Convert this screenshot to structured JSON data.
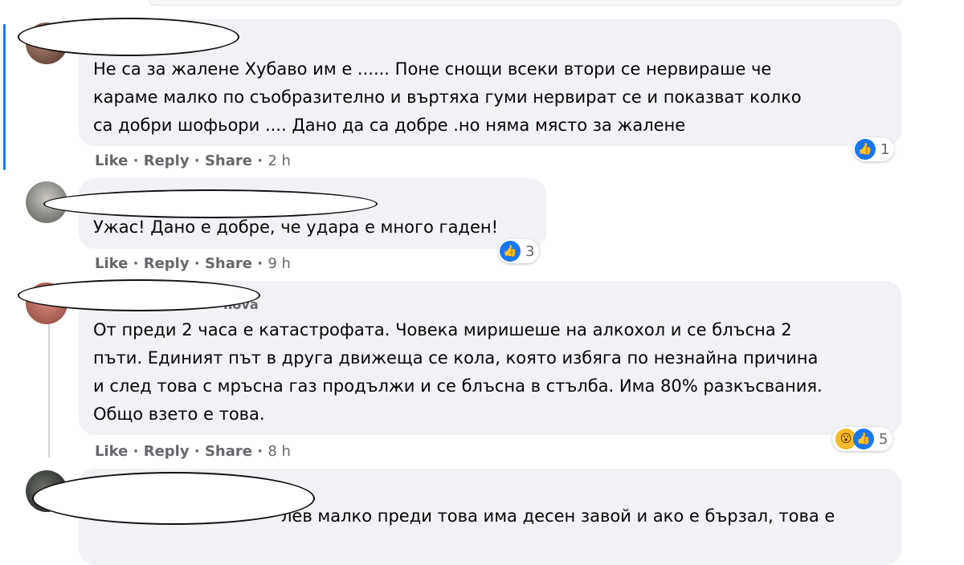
{
  "comments": [
    {
      "name": "",
      "lines": [
        "Не са за жалене Хубаво им е ...... Поне снощи всеки втори се нервираше че",
        "караме малко по съобразително и въртяха гуми нервират се и показват колко",
        "са добри шофьори .... Дано да са добре .но няма място за жалене"
      ],
      "actions": {
        "like": "Like",
        "reply": "Reply",
        "share": "Share",
        "time": "2 h"
      },
      "reactions": {
        "count": "1",
        "icons": [
          "like-icon"
        ]
      }
    },
    {
      "name": "",
      "lines": [
        "Ужас! Дано е добре, че удара е много гаден!"
      ],
      "actions": {
        "like": "Like",
        "reply": "Reply",
        "share": "Share",
        "time": "9 h"
      },
      "reactions": {
        "count": "3",
        "icons": [
          "like-icon"
        ]
      }
    },
    {
      "name": "nova",
      "lines": [
        "От преди 2 часа е катастрофата. Човека миришеше на алкохол и се блъсна 2",
        "пъти. Единият път в друга движеща се кола, която избяга по незнайна причина",
        "и след това с мръсна газ продължи и се блъсна в стълба. Има 80% разкъсвания.",
        "Общо взето е това."
      ],
      "actions": {
        "like": "Like",
        "reply": "Reply",
        "share": "Share",
        "time": "8 h"
      },
      "reactions": {
        "count": "5",
        "icons": [
          "wow-icon",
          "like-icon"
        ]
      }
    },
    {
      "name": "",
      "lines": [
        "лев малко преди това има десен завой и ако е бързал, това е"
      ],
      "actions": null,
      "reactions": null
    }
  ],
  "separator": " · "
}
